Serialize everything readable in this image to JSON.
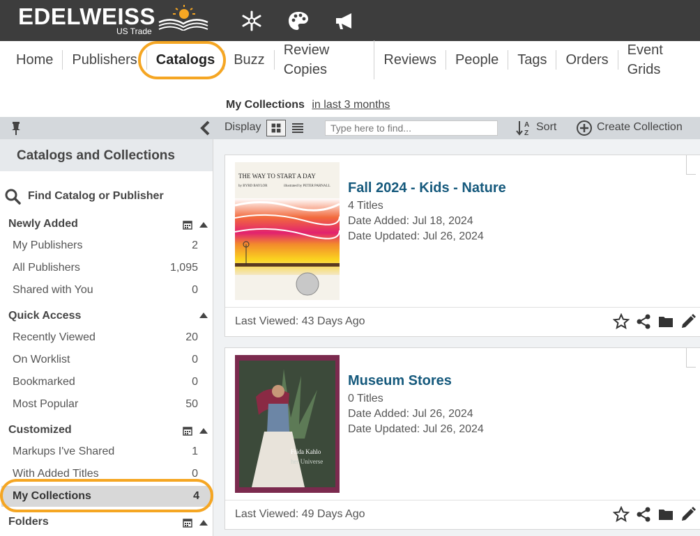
{
  "brand": {
    "name": "EDELWEISS",
    "sub": "US Trade"
  },
  "top_icons": [
    "snowflake-icon",
    "palette-icon",
    "megaphone-icon"
  ],
  "nav": [
    "Home",
    "Publishers",
    "Catalogs",
    "Buzz",
    "Review Copies",
    "Reviews",
    "People",
    "Tags",
    "Orders",
    "Event Grids"
  ],
  "nav_active": "Catalogs",
  "collections_header": {
    "title": "My Collections",
    "range": "in last 3 months"
  },
  "toolbar": {
    "display_label": "Display",
    "search_placeholder": "Type here to find...",
    "sort_label": "Sort",
    "create_label": "Create Collection"
  },
  "sidebar": {
    "title": "Catalogs and Collections",
    "find_label": "Find Catalog or Publisher",
    "sections": [
      {
        "title": "Newly Added",
        "items": [
          {
            "label": "My Publishers",
            "count": "2"
          },
          {
            "label": "All Publishers",
            "count": "1,095"
          },
          {
            "label": "Shared with You",
            "count": "0"
          }
        ]
      },
      {
        "title": "Quick Access",
        "items": [
          {
            "label": "Recently Viewed",
            "count": "20"
          },
          {
            "label": "On Worklist",
            "count": "0"
          },
          {
            "label": "Bookmarked",
            "count": "0"
          },
          {
            "label": "Most Popular",
            "count": "50"
          }
        ]
      },
      {
        "title": "Customized",
        "items": [
          {
            "label": "Markups I've Shared",
            "count": "1"
          },
          {
            "label": "With Added Titles",
            "count": "0"
          },
          {
            "label": "My Collections",
            "count": "4"
          }
        ]
      },
      {
        "title": "Folders",
        "items": []
      }
    ]
  },
  "cards": [
    {
      "title": "Fall 2024 - Kids - Nature",
      "titles": "4 Titles",
      "date_added": "Date Added: Jul 18, 2024",
      "date_updated": "Date Updated: Jul 26, 2024",
      "last_viewed": "Last Viewed: 43 Days Ago",
      "cover_title": "THE WAY TO START A DAY",
      "cover_author": "by BYRD BAYLOR",
      "cover_illustrator": "illustrated by PETER PARNALL"
    },
    {
      "title": "Museum Stores",
      "titles": "0 Titles",
      "date_added": "Date Added: Jul 26, 2024",
      "date_updated": "Date Updated: Jul 26, 2024",
      "last_viewed": "Last Viewed: 49 Days Ago",
      "cover_title": "Frida Kahlo",
      "cover_sub": "her Universe"
    }
  ],
  "colors": {
    "accent_highlight": "#f5a623",
    "link_title": "#15597c",
    "topbar": "#3d3d3d"
  }
}
